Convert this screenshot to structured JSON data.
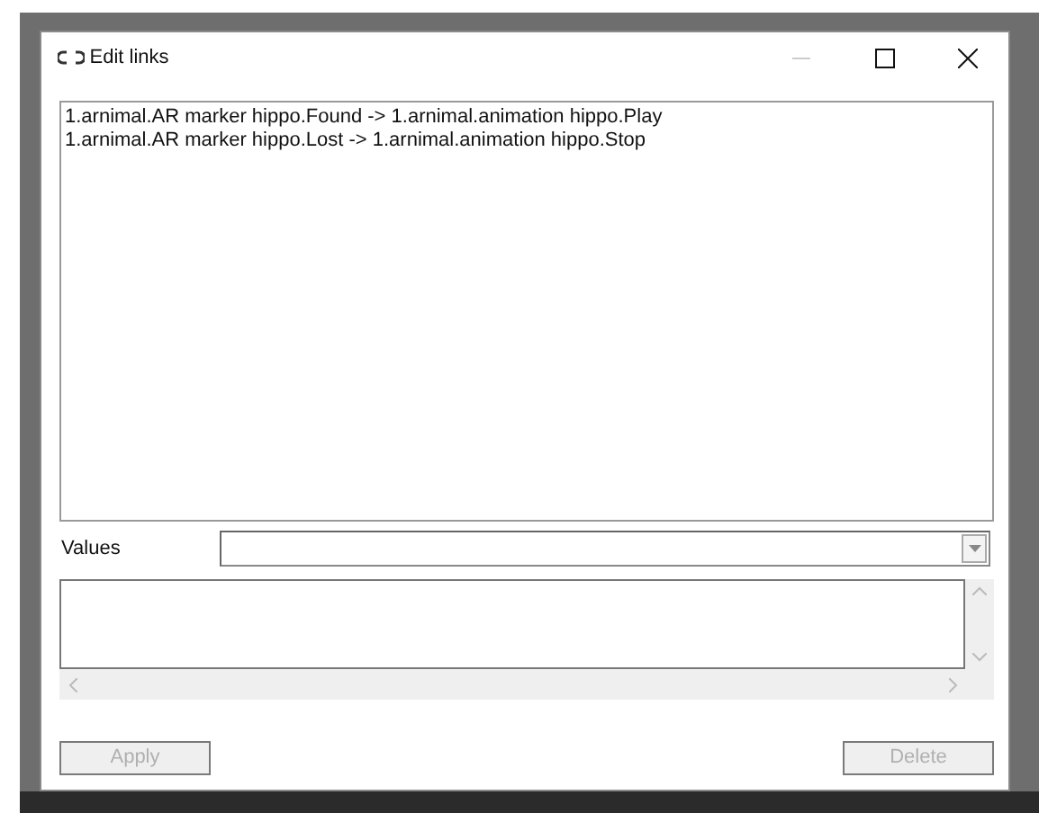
{
  "window": {
    "title": "Edit links"
  },
  "links": [
    {
      "text": "1.arnimal.AR marker hippo.Found -> 1.arnimal.animation hippo.Play"
    },
    {
      "text": "1.arnimal.AR marker hippo.Lost -> 1.arnimal.animation hippo.Stop"
    }
  ],
  "values": {
    "label": "Values"
  },
  "buttons": [
    {
      "label": "Apply",
      "disabled": true
    },
    {
      "label": "Delete",
      "disabled": true
    }
  ]
}
